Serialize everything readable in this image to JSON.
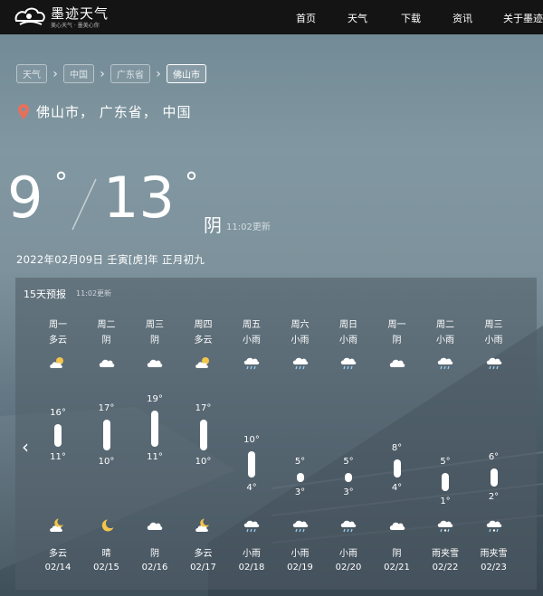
{
  "nav": {
    "logo_title": "墨迹天气",
    "logo_sub": "美心天气 · 墨美心你",
    "links": [
      "首页",
      "天气",
      "下载",
      "资讯",
      "关于墨迹"
    ]
  },
  "breadcrumb": [
    "天气",
    "中国",
    "广东省",
    "佛山市"
  ],
  "location": "佛山市， 广东省， 中国",
  "current": {
    "low": "9",
    "high": "13",
    "deg": "°",
    "condition": "阴",
    "update": "11:02更新",
    "date": "2022年02月09日 壬寅[虎]年 正月初九"
  },
  "forecast": {
    "title": "15天预报",
    "update": "11:02更新",
    "days": [
      {
        "week": "周一",
        "day_cond": "多云",
        "day_icon": "partly-cloudy",
        "high": 16,
        "low": 11,
        "high_label": "16°",
        "low_label": "11°",
        "night_icon": "cloudy-moon",
        "night_cond": "多云",
        "date": "02/14"
      },
      {
        "week": "周二",
        "day_cond": "阴",
        "day_icon": "cloud",
        "high": 17,
        "low": 10,
        "high_label": "17°",
        "low_label": "10°",
        "night_icon": "moon",
        "night_cond": "晴",
        "date": "02/15"
      },
      {
        "week": "周三",
        "day_cond": "阴",
        "day_icon": "cloud",
        "high": 19,
        "low": 11,
        "high_label": "19°",
        "low_label": "11°",
        "night_icon": "cloud",
        "night_cond": "阴",
        "date": "02/16"
      },
      {
        "week": "周四",
        "day_cond": "多云",
        "day_icon": "partly-cloudy",
        "high": 17,
        "low": 10,
        "high_label": "17°",
        "low_label": "10°",
        "night_icon": "cloudy-moon",
        "night_cond": "多云",
        "date": "02/17"
      },
      {
        "week": "周五",
        "day_cond": "小雨",
        "day_icon": "rain",
        "high": 10,
        "low": 4,
        "high_label": "10°",
        "low_label": "4°",
        "night_icon": "rain",
        "night_cond": "小雨",
        "date": "02/18"
      },
      {
        "week": "周六",
        "day_cond": "小雨",
        "day_icon": "rain",
        "high": 5,
        "low": 3,
        "high_label": "5°",
        "low_label": "3°",
        "night_icon": "rain",
        "night_cond": "小雨",
        "date": "02/19"
      },
      {
        "week": "周日",
        "day_cond": "小雨",
        "day_icon": "rain",
        "high": 5,
        "low": 3,
        "high_label": "5°",
        "low_label": "3°",
        "night_icon": "rain",
        "night_cond": "小雨",
        "date": "02/20"
      },
      {
        "week": "周一",
        "day_cond": "阴",
        "day_icon": "cloud",
        "high": 8,
        "low": 4,
        "high_label": "8°",
        "low_label": "4°",
        "night_icon": "cloud",
        "night_cond": "阴",
        "date": "02/21"
      },
      {
        "week": "周二",
        "day_cond": "小雨",
        "day_icon": "rain",
        "high": 5,
        "low": 1,
        "high_label": "5°",
        "low_label": "1°",
        "night_icon": "sleet",
        "night_cond": "雨夹雪",
        "date": "02/22"
      },
      {
        "week": "周三",
        "day_cond": "小雨",
        "day_icon": "rain",
        "high": 6,
        "low": 2,
        "high_label": "6°",
        "low_label": "2°",
        "night_icon": "sleet",
        "night_cond": "雨夹雪",
        "date": "02/23"
      }
    ]
  }
}
